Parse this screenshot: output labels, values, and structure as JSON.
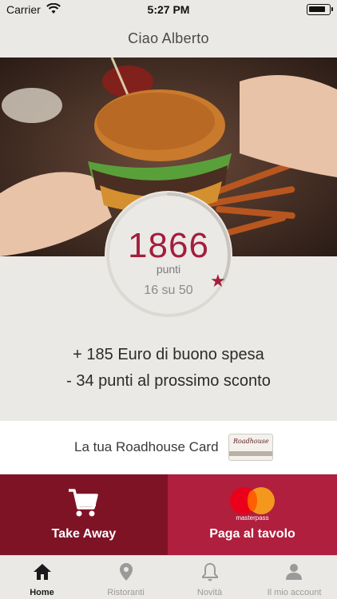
{
  "status_bar": {
    "carrier": "Carrier",
    "time": "5:27 PM"
  },
  "header": {
    "title": "Ciao Alberto"
  },
  "hero": {
    "image": "burger-photo"
  },
  "points": {
    "value": "1866",
    "unit": "punti",
    "progress_text": "16 su 50",
    "progress_fraction": 0.32,
    "star_icon": "star-icon"
  },
  "rewards": {
    "voucher_text": "+ 185 Euro di buono spesa",
    "next_discount_text": "- 34 punti al prossimo sconto"
  },
  "card": {
    "label": "La tua Roadhouse Card",
    "brand": "Roadhouse"
  },
  "actions": {
    "takeaway_label": "Take Away",
    "pay_label": "Paga al tavolo",
    "mastercard_text": "masterpass"
  },
  "tabs": [
    {
      "label": "Home",
      "icon": "home-icon",
      "active": true
    },
    {
      "label": "Ristoranti",
      "icon": "location-pin-icon",
      "active": false
    },
    {
      "label": "Novità",
      "icon": "bell-icon",
      "active": false
    },
    {
      "label": "Il mio account",
      "icon": "user-icon",
      "active": false
    }
  ],
  "colors": {
    "accent": "#a31e3d",
    "takeaway_bg": "#7e1326",
    "pay_bg": "#b01f3d",
    "background": "#ebe9e6"
  }
}
